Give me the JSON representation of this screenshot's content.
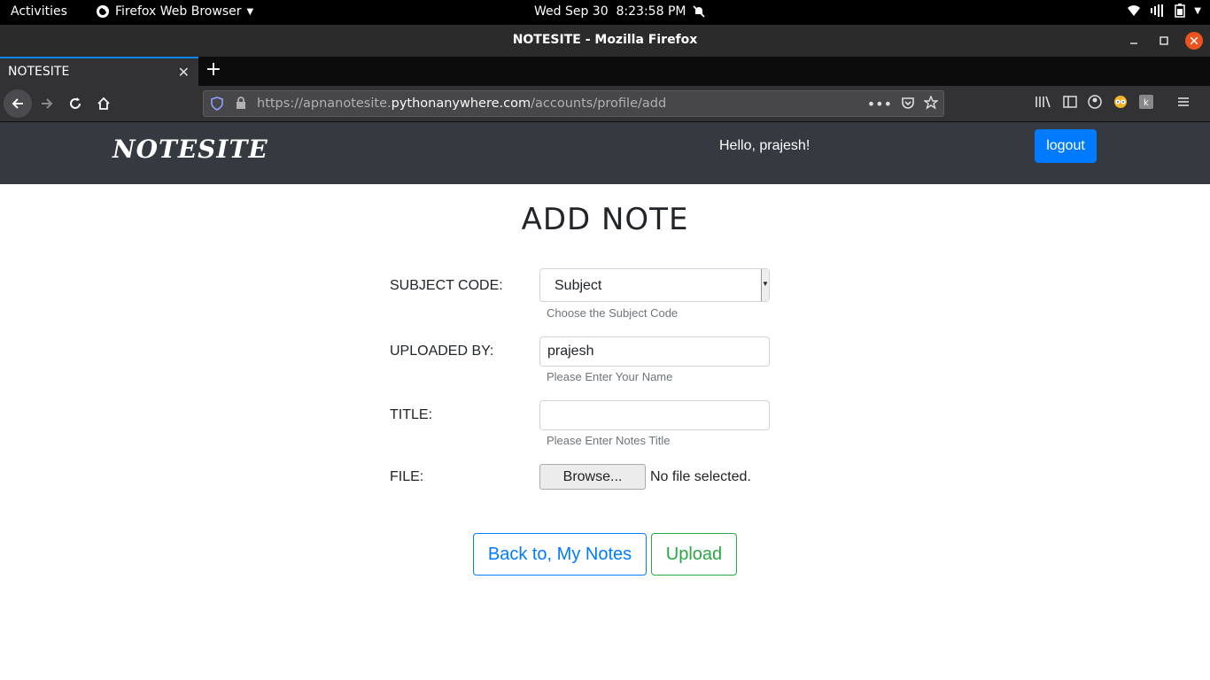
{
  "system_bar": {
    "activities": "Activities",
    "app_name": "Firefox Web Browser",
    "datetime": "Wed Sep 30  8:23:58 PM"
  },
  "window": {
    "title": "NOTESITE - Mozilla Firefox"
  },
  "tabs": [
    {
      "label": "NOTESITE",
      "active": true
    }
  ],
  "url": {
    "scheme": "https://apnanotesite.",
    "host": "pythonanywhere.com",
    "path": "/accounts/profile/add"
  },
  "site": {
    "brand": "NOTESITE",
    "greeting": "Hello, prajesh!",
    "logout_label": "logout",
    "accent_color": "#007bff",
    "header_color": "#343a40"
  },
  "form": {
    "title": "ADD NOTE",
    "subject": {
      "label": "SUBJECT CODE:",
      "selected": "Subject",
      "help": "Choose the Subject Code"
    },
    "uploaded_by": {
      "label": "UPLOADED BY:",
      "value": "prajesh",
      "help": "Please Enter Your Name"
    },
    "title_field": {
      "label": "TITLE:",
      "value": "",
      "help": "Please Enter Notes Title"
    },
    "file": {
      "label": "FILE:",
      "browse_label": "Browse...",
      "status": "No file selected."
    },
    "back_label": "Back to, My Notes",
    "upload_label": "Upload",
    "upload_color": "#28a745"
  }
}
